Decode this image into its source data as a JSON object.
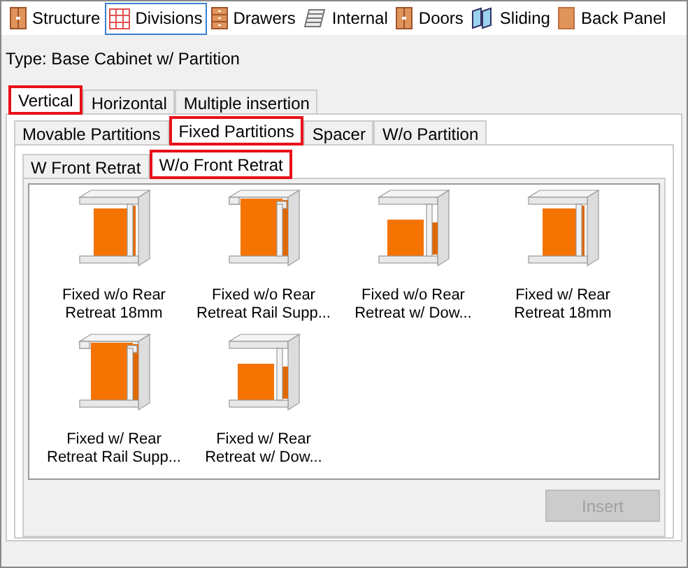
{
  "toolbar": [
    {
      "label": "Structure",
      "kind": "cabinet",
      "selected": false
    },
    {
      "label": "Divisions",
      "kind": "grid",
      "selected": true
    },
    {
      "label": "Drawers",
      "kind": "drawers",
      "selected": false
    },
    {
      "label": "Internal",
      "kind": "shelves",
      "selected": false
    },
    {
      "label": "Doors",
      "kind": "cabinet",
      "selected": false
    },
    {
      "label": "Sliding",
      "kind": "sliding",
      "selected": false
    },
    {
      "label": "Back Panel",
      "kind": "panel",
      "selected": false
    }
  ],
  "type_label": "Type: Base Cabinet w/ Partition",
  "tabs": [
    {
      "label": "Vertical",
      "selected": true,
      "highlighted": true
    },
    {
      "label": "Horizontal",
      "selected": false,
      "highlighted": false
    },
    {
      "label": "Multiple insertion",
      "selected": false,
      "highlighted": false
    }
  ],
  "subtabs": [
    {
      "label": "Movable Partitions",
      "selected": false,
      "highlighted": false
    },
    {
      "label": "Fixed Partitions",
      "selected": true,
      "highlighted": true
    },
    {
      "label": "Spacer",
      "selected": false,
      "highlighted": false
    },
    {
      "label": "W/o Partition",
      "selected": false,
      "highlighted": false
    }
  ],
  "subsubtabs": [
    {
      "label": "W Front Retrat",
      "selected": false,
      "highlighted": false
    },
    {
      "label": "W/o Front Retrat",
      "selected": true,
      "highlighted": true
    }
  ],
  "items": [
    {
      "label": "Fixed w/o Rear Retreat 18mm",
      "kind": "plain"
    },
    {
      "label": "Fixed w/o Rear Retreat Rail Supp...",
      "kind": "rail"
    },
    {
      "label": "Fixed w/o Rear Retreat w/ Dow...",
      "kind": "dowel"
    },
    {
      "label": "Fixed w/ Rear Retreat 18mm",
      "kind": "plain"
    },
    {
      "label": "Fixed w/ Rear Retreat Rail Supp...",
      "kind": "rail"
    },
    {
      "label": "Fixed w/ Rear Retreat w/ Dow...",
      "kind": "dowel"
    }
  ],
  "insert_button": {
    "label": "Insert",
    "disabled": true
  }
}
